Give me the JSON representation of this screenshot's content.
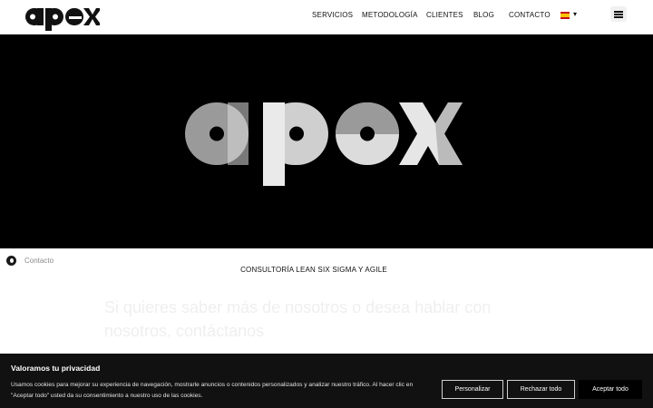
{
  "header": {
    "logo_alt": "apex",
    "nav": [
      "SERVICIOS",
      "METODOLOGÍA",
      "CLIENTES",
      "BLOG",
      "CONTACTO"
    ],
    "language_flag": "es-flag-icon",
    "language_caret": "▾",
    "menu_icon": "hamburger-icon"
  },
  "hero": {
    "logo_text": "apex"
  },
  "breadcrumb": {
    "icon": "apex-mark-icon",
    "label": "Contacto"
  },
  "page": {
    "subtitle": "CONSULTORÍA LEAN SIX SIGMA Y AGILE",
    "faded_heading": "Si quieres saber más de nosotros o desea hablar con nosotros, contáctanos"
  },
  "cookie_banner": {
    "title": "Valoramos tu privacidad",
    "text": "Usamos cookies para mejorar su experiencia de navegación, mostrarle anuncios o contenidos personalizados y analizar nuestro tráfico. Al hacer clic en \"Aceptar todo\" usted da su consentimiento a nuestro uso de las cookies.",
    "buttons": {
      "customize": "Personalizar",
      "reject": "Rechazar todo",
      "accept": "Aceptar todo"
    }
  },
  "colors": {
    "hero_background": "#000000",
    "banner_background": "#111111",
    "logo_grey": "#9a9a9a",
    "logo_light": "#dcdcdc"
  }
}
